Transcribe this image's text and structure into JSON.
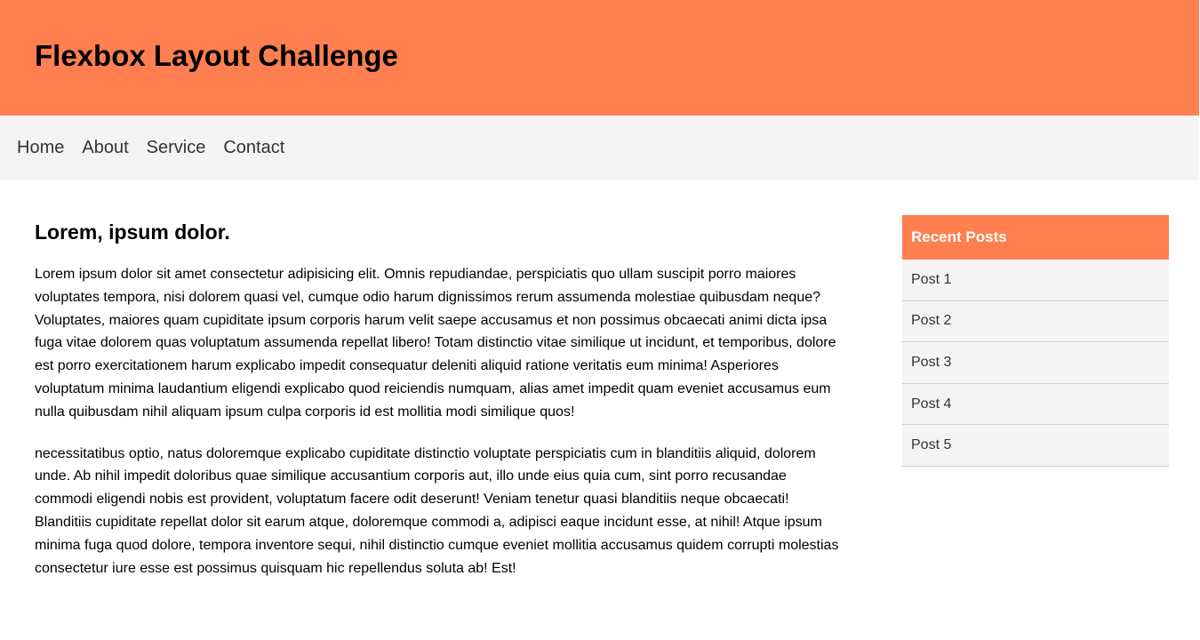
{
  "header": {
    "title": "Flexbox Layout Challenge"
  },
  "nav": {
    "items": [
      {
        "label": "Home"
      },
      {
        "label": "About"
      },
      {
        "label": "Service"
      },
      {
        "label": "Contact"
      }
    ]
  },
  "main": {
    "heading": "Lorem, ipsum dolor.",
    "paragraphs": [
      "Lorem ipsum dolor sit amet consectetur adipisicing elit. Omnis repudiandae, perspiciatis quo ullam suscipit porro maiores voluptates tempora, nisi dolorem quasi vel, cumque odio harum dignissimos rerum assumenda molestiae quibusdam neque? Voluptates, maiores quam cupiditate ipsum corporis harum velit saepe accusamus et non possimus obcaecati animi dicta ipsa fuga vitae dolorem quas voluptatum assumenda repellat libero! Totam distinctio vitae similique ut incidunt, et temporibus, dolore est porro exercitationem harum explicabo impedit consequatur deleniti aliquid ratione veritatis eum minima! Asperiores voluptatum minima laudantium eligendi explicabo quod reiciendis numquam, alias amet impedit quam eveniet accusamus eum nulla quibusdam nihil aliquam ipsum culpa corporis id est mollitia modi similique quos!",
      "necessitatibus optio, natus doloremque explicabo cupiditate distinctio voluptate perspiciatis cum in blanditiis aliquid, dolorem unde. Ab nihil impedit doloribus quae similique accusantium corporis aut, illo unde eius quia cum, sint porro recusandae commodi eligendi nobis est provident, voluptatum facere odit deserunt! Veniam tenetur quasi blanditiis neque obcaecati! Blanditiis cupiditate repellat dolor sit earum atque, doloremque commodi a, adipisci eaque incidunt esse, at nihil! Atque ipsum minima fuga quod dolore, tempora inventore sequi, nihil distinctio cumque eveniet mollitia accusamus quidem corrupti molestias consectetur iure esse est possimus quisquam hic repellendus soluta ab! Est!"
    ]
  },
  "sidebar": {
    "title": "Recent Posts",
    "posts": [
      {
        "label": "Post 1"
      },
      {
        "label": "Post 2"
      },
      {
        "label": "Post 3"
      },
      {
        "label": "Post 4"
      },
      {
        "label": "Post 5"
      }
    ]
  },
  "colors": {
    "accent": "#ff7f50",
    "nav_background": "#f4f4f4",
    "post_divider": "#cccccc"
  }
}
